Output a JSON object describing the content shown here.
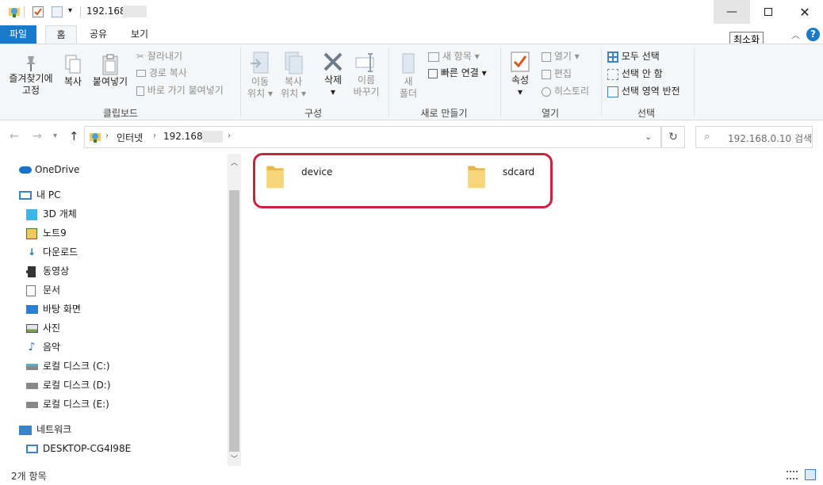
{
  "window": {
    "title": "192.168.",
    "minimize_tooltip": "최소화"
  },
  "ribbon_tabs": {
    "file": "파일",
    "home": "홈",
    "share": "공유",
    "view": "보기"
  },
  "ribbon": {
    "clipboard": {
      "pin_label_1": "즐겨찾기에",
      "pin_label_2": "고정",
      "copy": "복사",
      "paste": "붙여넣기",
      "cut": "잘라내기",
      "copy_path": "경로 복사",
      "paste_shortcut": "바로 가기 붙여넣기",
      "group": "클립보드"
    },
    "organize": {
      "move_1": "이동",
      "move_2": "위치",
      "copy_1": "복사",
      "copy_2": "위치",
      "delete": "삭제",
      "rename_1": "이름",
      "rename_2": "바꾸기",
      "group": "구성"
    },
    "new": {
      "new_folder_1": "새",
      "new_folder_2": "폴더",
      "new_item": "새 항목",
      "easy_access": "빠른 연결",
      "group": "새로 만들기"
    },
    "open": {
      "properties": "속성",
      "open": "열기",
      "edit": "편집",
      "history": "히스토리",
      "group": "열기"
    },
    "select": {
      "select_all": "모두 선택",
      "select_none": "선택 안 함",
      "invert": "선택 영역 반전",
      "group": "선택"
    }
  },
  "address": {
    "crumbs": [
      "인터넷",
      "192.168."
    ],
    "search_placeholder": "192.168.0.10 검색"
  },
  "nav_pane": {
    "onedrive": "OneDrive",
    "this_pc": "내 PC",
    "items": [
      "3D 개체",
      "노트9",
      "다운로드",
      "동영상",
      "문서",
      "바탕 화면",
      "사진",
      "음악",
      "로컬 디스크 (C:)",
      "로컬 디스크 (D:)",
      "로컬 디스크 (E:)"
    ],
    "network": "네트워크",
    "desktop": "DESKTOP-CG4I98E"
  },
  "content": {
    "folders": [
      "device",
      "sdcard"
    ]
  },
  "status": {
    "count": "2개 항목"
  },
  "colors": {
    "accent": "#1979ca",
    "highlight_box": "#c8243f",
    "folder": "#f4c95d"
  }
}
